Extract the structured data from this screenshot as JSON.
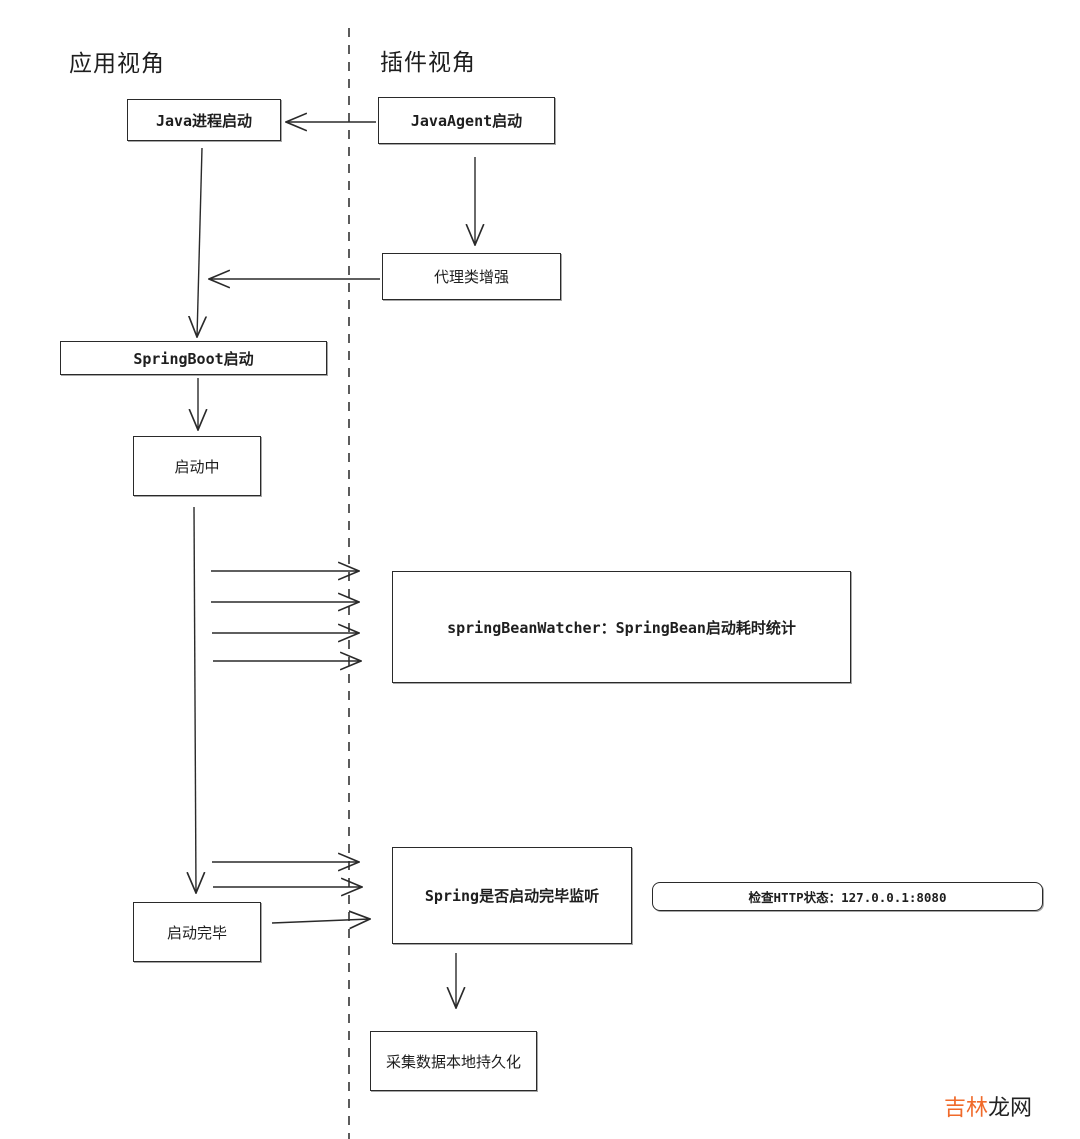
{
  "lanes": {
    "app_view": "应用视角",
    "plugin_view": "插件视角"
  },
  "nodes": {
    "java_process_start": "Java进程启动",
    "javaagent_start": "JavaAgent启动",
    "proxy_enhance": "代理类增强",
    "springboot_start": "SpringBoot启动",
    "starting": "启动中",
    "bean_watcher": "springBeanWatcher：SpringBean启动耗时统计",
    "startup_listener": "Spring是否启动完毕监听",
    "http_check": "检查HTTP状态：127.0.0.1:8080",
    "startup_done": "启动完毕",
    "persist_data": "采集数据本地持久化"
  },
  "edges": [
    {
      "from": "javaagent_start",
      "to": "java_process_start"
    },
    {
      "from": "javaagent_start",
      "to": "proxy_enhance"
    },
    {
      "from": "proxy_enhance",
      "to": "java_process_start-flow"
    },
    {
      "from": "java_process_start",
      "to": "springboot_start"
    },
    {
      "from": "springboot_start",
      "to": "starting"
    },
    {
      "from": "starting",
      "to": "bean_watcher",
      "count": 4
    },
    {
      "from": "starting",
      "to": "startup_done"
    },
    {
      "from": "starting",
      "to": "startup_listener",
      "count": 2
    },
    {
      "from": "startup_done",
      "to": "startup_listener"
    },
    {
      "from": "startup_listener",
      "to": "persist_data"
    }
  ],
  "watermark": {
    "part1": "吉林",
    "part2": "龙网"
  }
}
